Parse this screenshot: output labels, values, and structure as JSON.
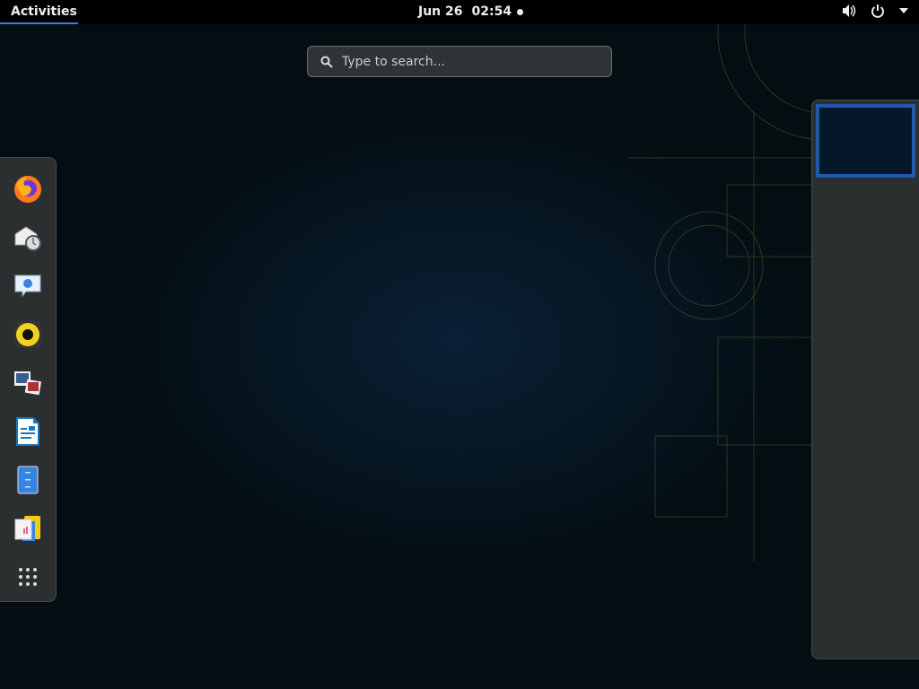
{
  "topbar": {
    "activities": "Activities",
    "date": "Jun 26",
    "time": "02:54"
  },
  "search": {
    "placeholder": "Type to search..."
  },
  "dash": {
    "items": [
      "Firefox",
      "Evolution",
      "Empathy",
      "Rhythmbox",
      "Shotwell",
      "LibreOffice Writer",
      "Files",
      "Documents",
      "Show Applications"
    ]
  },
  "colors": {
    "accent": "#3584e4",
    "panel": "#2b2f30"
  }
}
